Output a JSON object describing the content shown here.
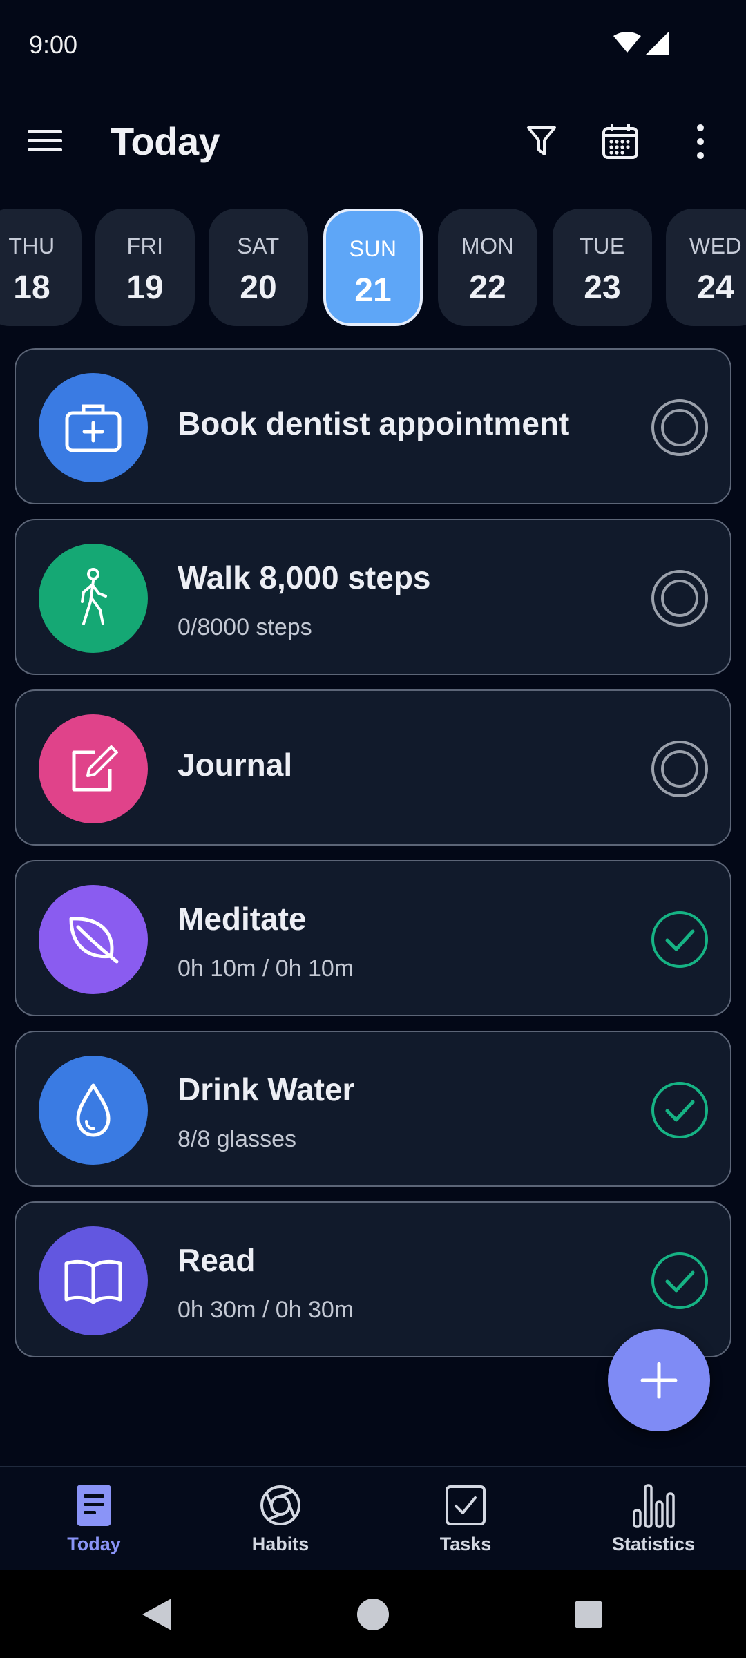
{
  "status_bar": {
    "time": "9:00"
  },
  "app_bar": {
    "title": "Today"
  },
  "date_strip": [
    {
      "dow": "THU",
      "num": "18",
      "selected": false
    },
    {
      "dow": "FRI",
      "num": "19",
      "selected": false
    },
    {
      "dow": "SAT",
      "num": "20",
      "selected": false
    },
    {
      "dow": "SUN",
      "num": "21",
      "selected": true
    },
    {
      "dow": "MON",
      "num": "22",
      "selected": false
    },
    {
      "dow": "TUE",
      "num": "23",
      "selected": false
    },
    {
      "dow": "WED",
      "num": "24",
      "selected": false
    }
  ],
  "items": [
    {
      "title": "Book dentist appointment",
      "subtitle": "",
      "icon": "medical-kit-icon",
      "color": "#3a7be3",
      "done": false
    },
    {
      "title": "Walk 8,000 steps",
      "subtitle": "0/8000 steps",
      "icon": "walking-person-icon",
      "color": "#15a874",
      "done": false
    },
    {
      "title": "Journal",
      "subtitle": "",
      "icon": "edit-note-icon",
      "color": "#e0438a",
      "done": false
    },
    {
      "title": "Meditate",
      "subtitle": "0h 10m / 0h 10m",
      "icon": "leaf-icon",
      "color": "#8a5cf0",
      "done": true
    },
    {
      "title": "Drink Water",
      "subtitle": "8/8 glasses",
      "icon": "water-drop-icon",
      "color": "#3a7be3",
      "done": true
    },
    {
      "title": "Read",
      "subtitle": "0h 30m / 0h 30m",
      "icon": "open-book-icon",
      "color": "#6257e0",
      "done": true
    }
  ],
  "bottom_nav": [
    {
      "label": "Today",
      "icon": "today-icon",
      "active": true
    },
    {
      "label": "Habits",
      "icon": "habits-icon",
      "active": false
    },
    {
      "label": "Tasks",
      "icon": "tasks-icon",
      "active": false
    },
    {
      "label": "Statistics",
      "icon": "statistics-icon",
      "active": false
    }
  ],
  "colors": {
    "background": "#030817",
    "card": "#111a2b",
    "selected_day": "#5ea6f7",
    "check_done": "#16b384",
    "check_pending": "#9aa0ab",
    "fab": "#7f8bf5",
    "nav_active": "#8a94f7"
  }
}
